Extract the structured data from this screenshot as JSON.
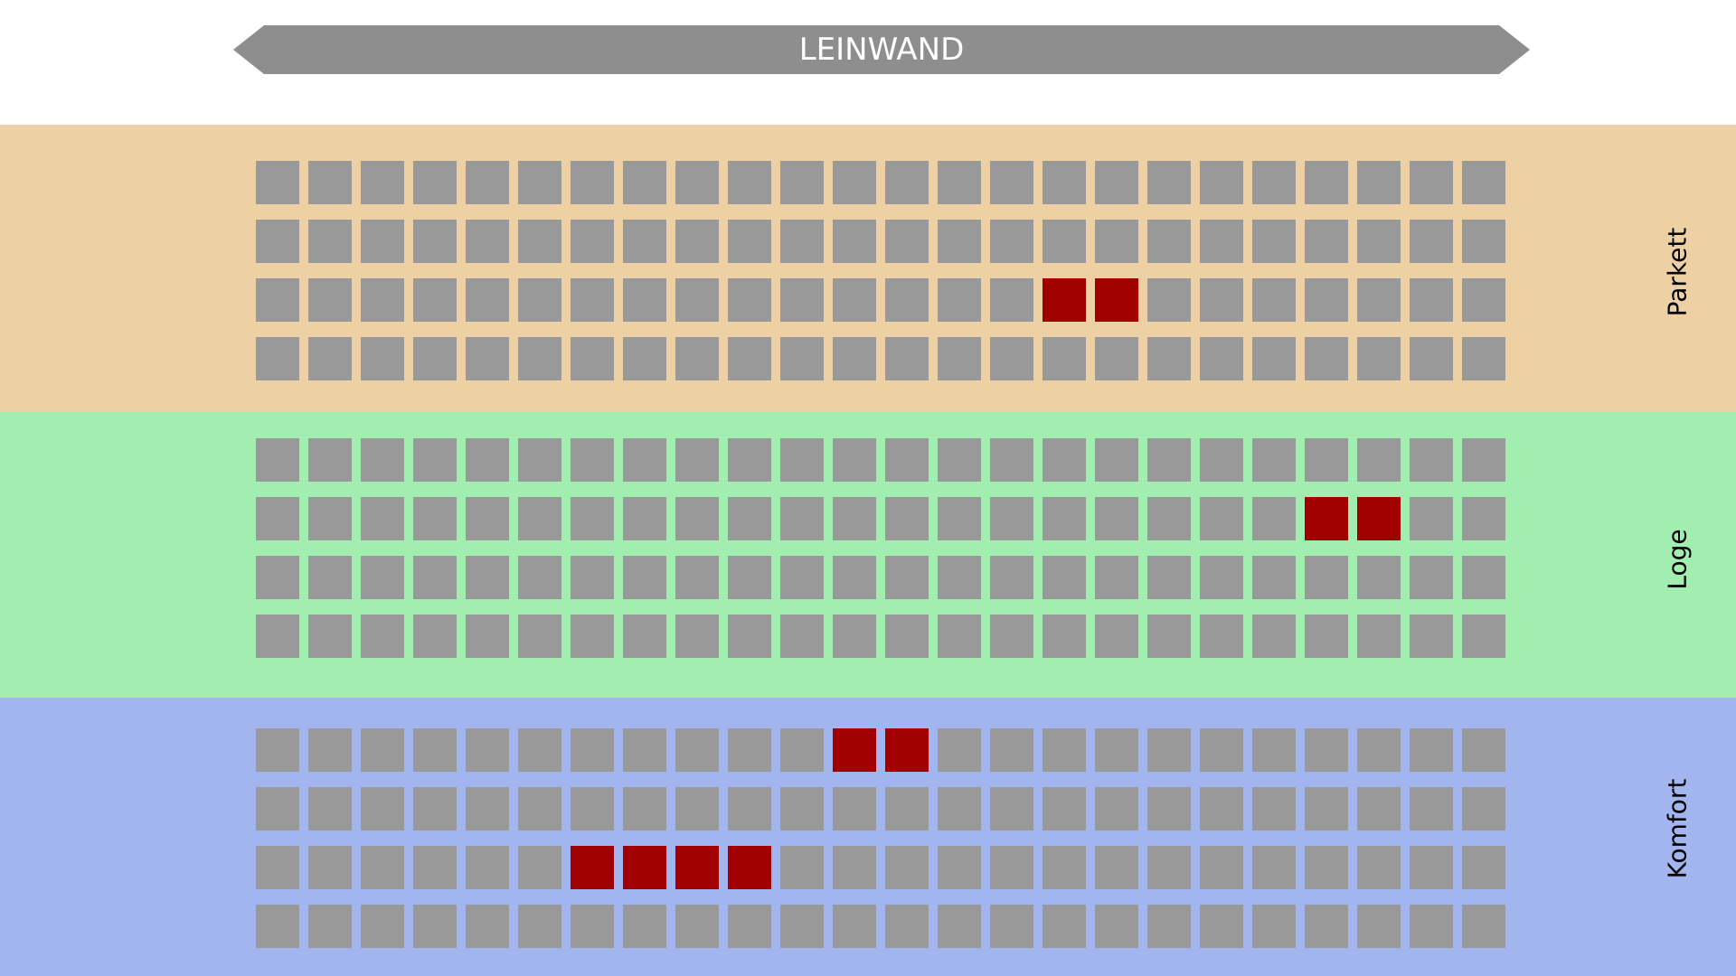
{
  "screen": {
    "label": "LEINWAND",
    "color": "#8e8e8e"
  },
  "colors": {
    "seat_free": "#999999",
    "seat_taken": "#a10000"
  },
  "layout_info": {
    "rows_per_section": 4,
    "seats_per_row": 24
  },
  "sections": [
    {
      "name": "Parkett",
      "color": "#edd1a5",
      "taken": [
        [
          2,
          15
        ],
        [
          2,
          16
        ]
      ]
    },
    {
      "name": "Loge",
      "color": "#a2eeb0",
      "taken": [
        [
          1,
          20
        ],
        [
          1,
          21
        ]
      ]
    },
    {
      "name": "Komfort",
      "color": "#a2b5ee",
      "taken": [
        [
          0,
          11
        ],
        [
          0,
          12
        ],
        [
          2,
          6
        ],
        [
          2,
          7
        ],
        [
          2,
          8
        ],
        [
          2,
          9
        ]
      ]
    }
  ]
}
